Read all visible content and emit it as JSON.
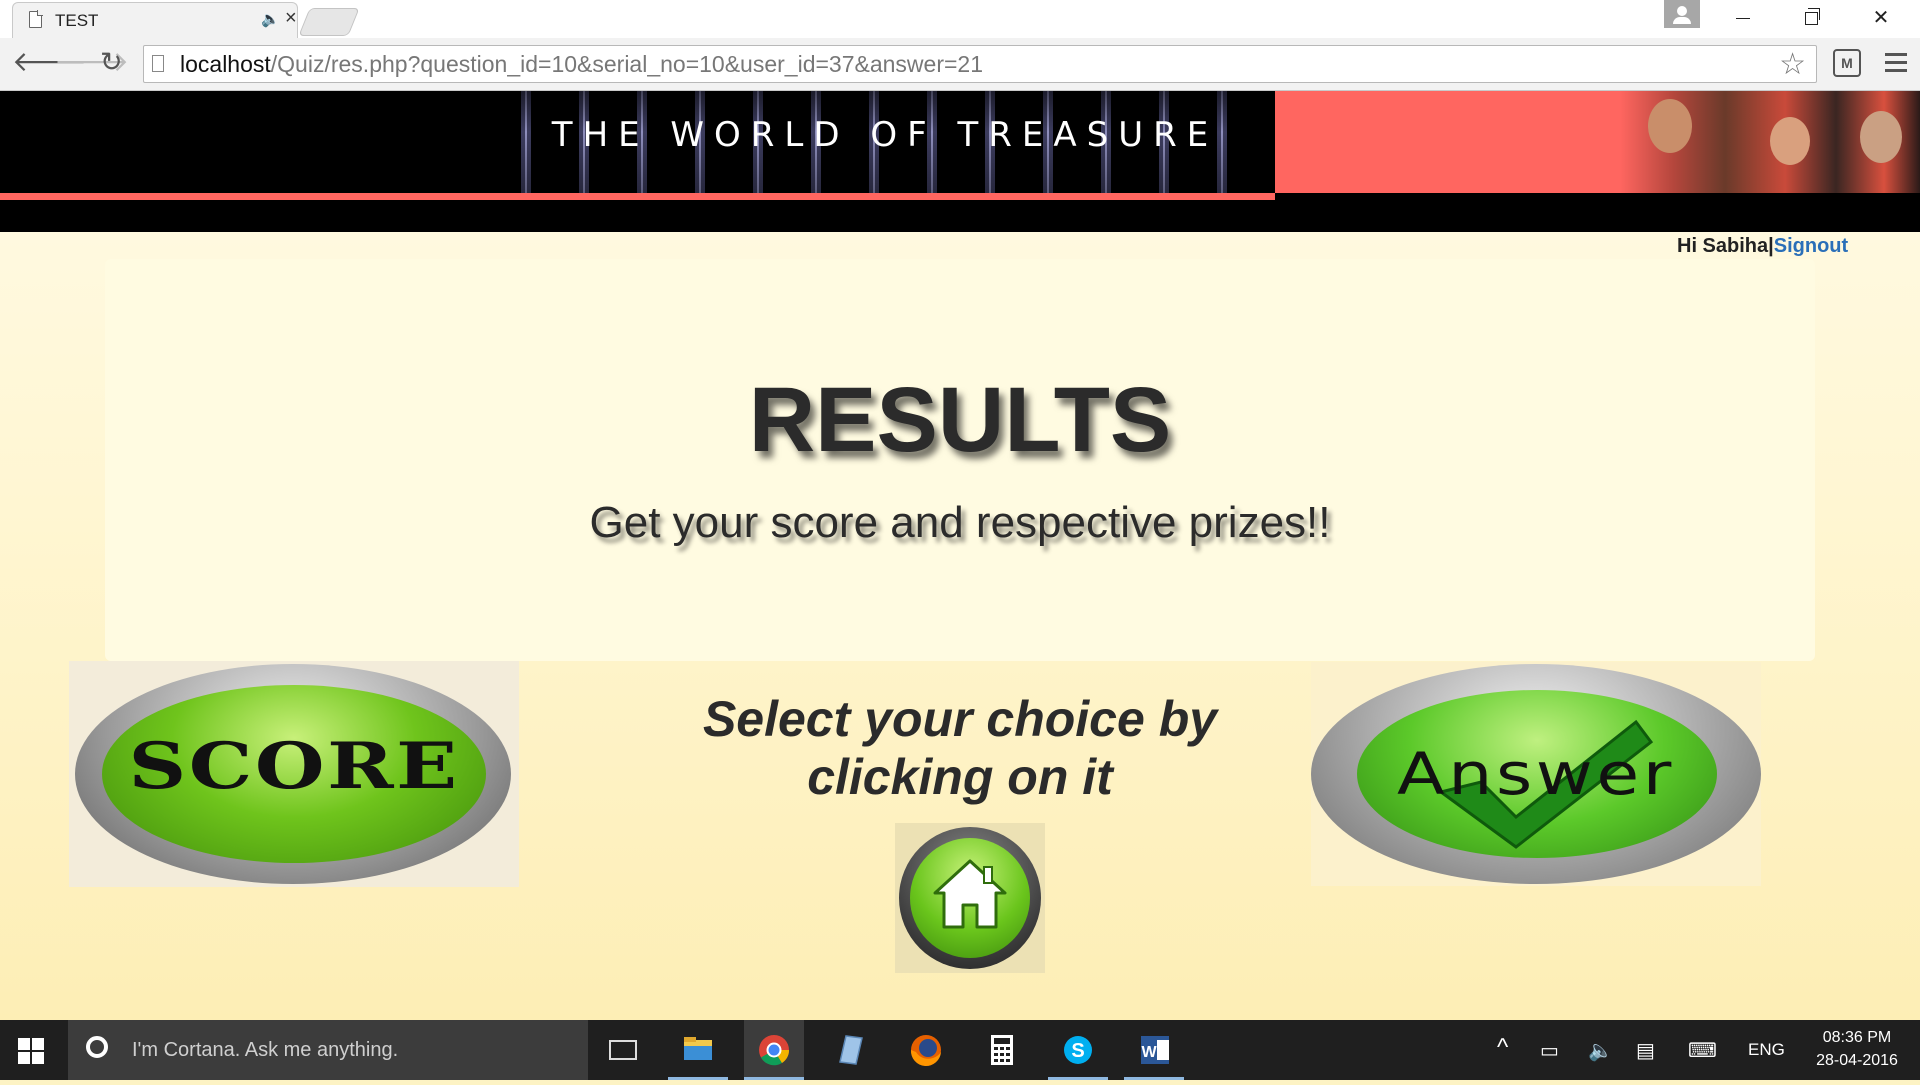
{
  "browser": {
    "tab_title": "TEST",
    "url_host": "localhost",
    "url_path": "/Quiz/res.php?question_id=10&serial_no=10&user_id=37&answer=21"
  },
  "site": {
    "banner_title": "THE WORLD OF TREASURE",
    "greeting": "Hi Sabiha|",
    "signout": "Signout",
    "results_title": "RESULTS",
    "results_subtitle": "Get your score and respective prizes!!",
    "choice_line1": "Select your choice by",
    "choice_line2": "clicking on it",
    "score_label": "SCORE",
    "answer_label": "Answer",
    "colors": {
      "banner_pink": "#ff6660",
      "link_blue": "#2a6fb8",
      "button_green": "#6fc41c"
    }
  },
  "taskbar": {
    "cortana_placeholder": "I'm Cortana. Ask me anything.",
    "language": "ENG",
    "time": "08:36 PM",
    "date": "28-04-2016",
    "apps": [
      "file-explorer-icon",
      "chrome-icon",
      "notepad-icon",
      "firefox-icon",
      "calculator-icon",
      "skype-icon",
      "word-icon"
    ]
  }
}
